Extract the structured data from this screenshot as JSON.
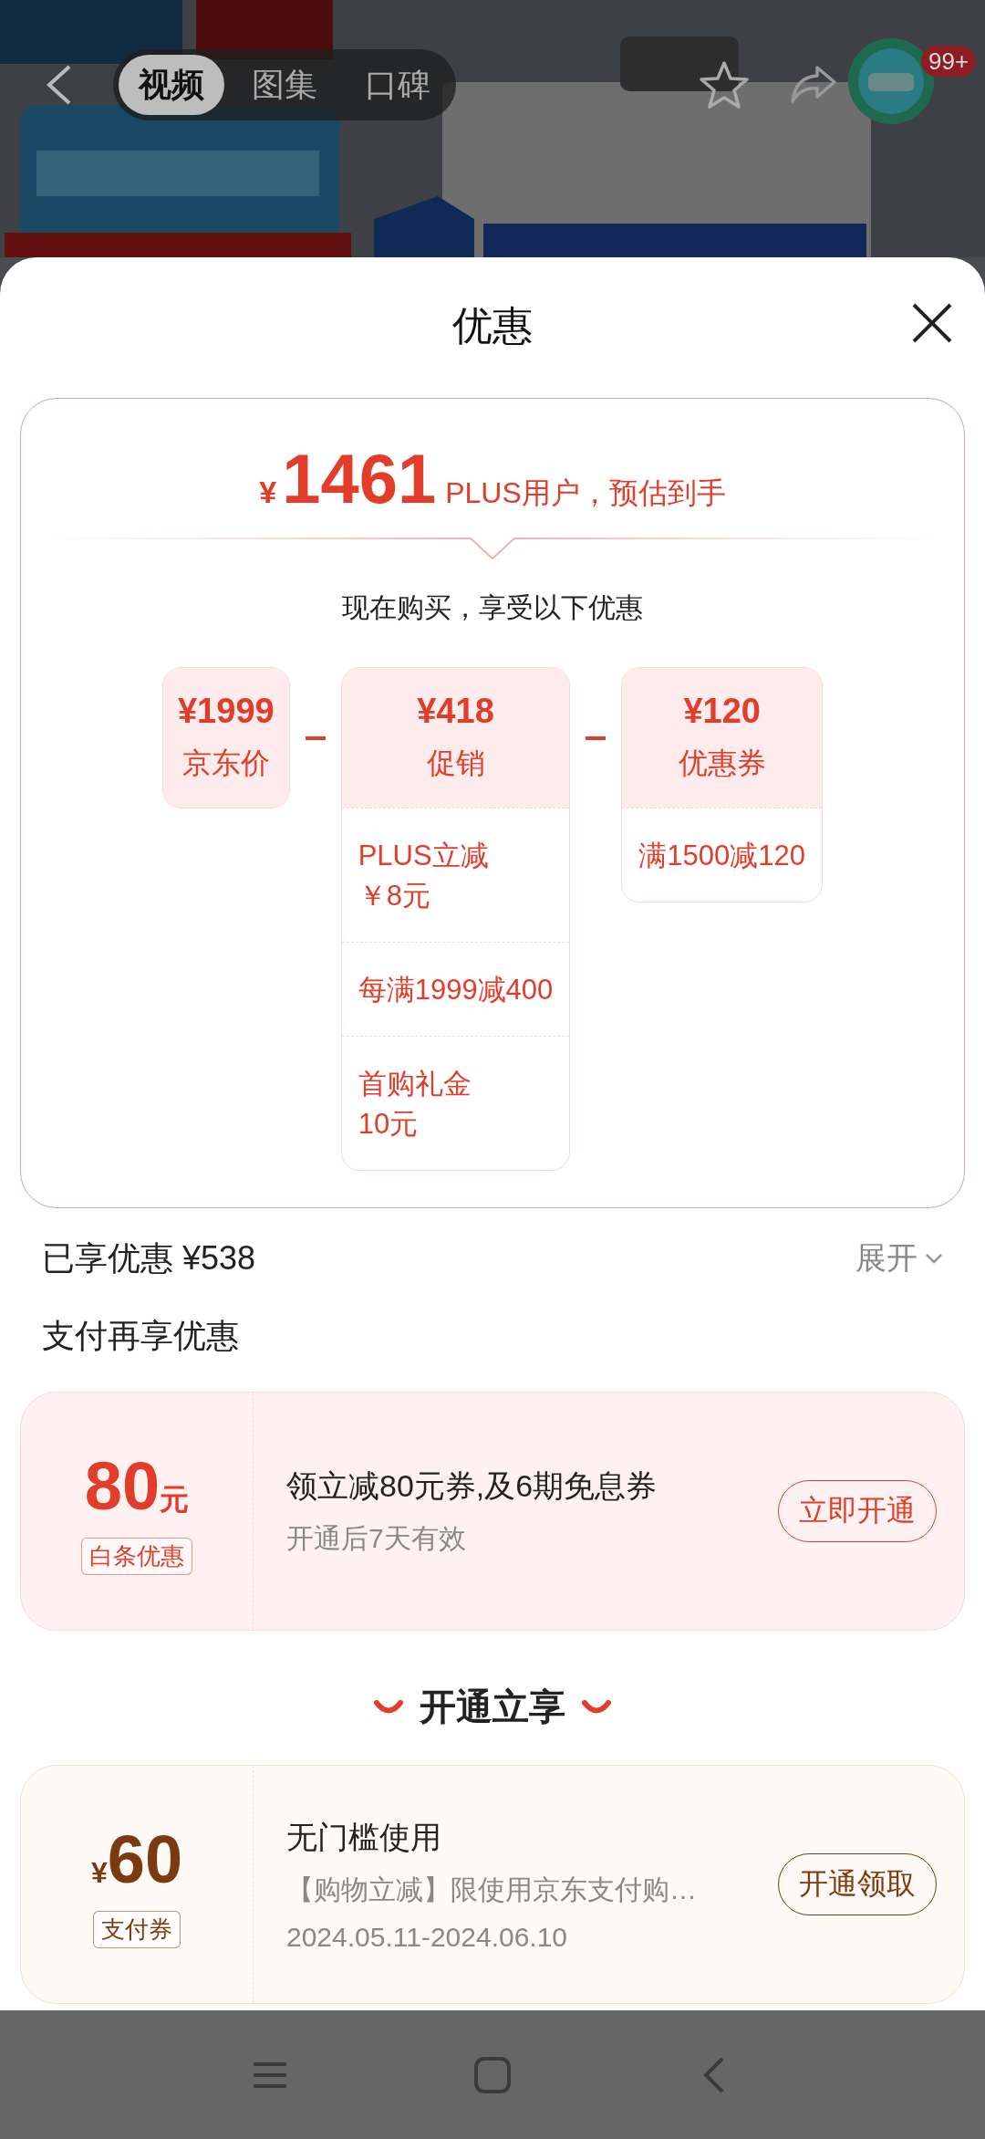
{
  "top_bar": {
    "tabs": [
      {
        "label": "视频",
        "selected": true
      },
      {
        "label": "图集",
        "selected": false
      },
      {
        "label": "口碑",
        "selected": false
      }
    ],
    "badge": "99+"
  },
  "sheet": {
    "title": "优惠"
  },
  "estimate": {
    "currency": "¥",
    "price": "1461",
    "caption": "PLUS用户，预估到手",
    "subtitle": "现在购买，享受以下优惠",
    "items": [
      {
        "currency": "¥",
        "amount": "1999",
        "label": "京东价"
      },
      {
        "currency": "¥",
        "amount": "418",
        "label": "促销",
        "details": [
          {
            "lines": [
              "PLUS立减",
              "￥8元"
            ]
          },
          {
            "lines": [
              "每满1999减400"
            ]
          },
          {
            "lines": [
              "首购礼金",
              "10元"
            ]
          }
        ]
      },
      {
        "currency": "¥",
        "amount": "120",
        "label": "优惠券",
        "details": [
          {
            "lines": [
              "满1500减120"
            ]
          }
        ]
      }
    ]
  },
  "saved": {
    "label": "已享优惠 ¥538",
    "toggle": "展开"
  },
  "pay_section": {
    "title": "支付再享优惠",
    "offer": {
      "kind": "baitiao",
      "amount": "80",
      "unit": "元",
      "tag": "白条优惠",
      "title": "领立减80元券,及6期免息券",
      "desc": "开通后7天有效",
      "button": "立即开通"
    }
  },
  "join_section": {
    "title": "开通立享",
    "offers": [
      {
        "kind": "pay",
        "currency": "¥",
        "amount": "60",
        "tag": "支付券",
        "title": "无门槛使用",
        "desc": "【购物立减】限使用京东支付购…",
        "date": "2024.05.11-2024.06.10",
        "button": "开通领取"
      }
    ]
  }
}
